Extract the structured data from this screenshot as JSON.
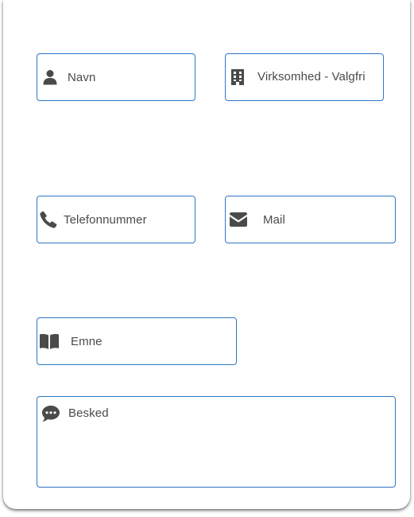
{
  "form": {
    "name": {
      "placeholder": "Navn",
      "icon": "user-icon"
    },
    "company": {
      "placeholder": "Virksomhed - Valgfri",
      "icon": "building-icon"
    },
    "phone": {
      "placeholder": "Telefonnummer",
      "icon": "phone-icon"
    },
    "mail": {
      "placeholder": "Mail",
      "icon": "envelope-icon"
    },
    "subject": {
      "placeholder": "Emne",
      "icon": "book-icon"
    },
    "message": {
      "placeholder": "Besked",
      "icon": "comment-dots-icon"
    }
  },
  "colors": {
    "border": "#2f76c6",
    "icon": "#4a4a4a",
    "text": "#4a4a4a"
  }
}
